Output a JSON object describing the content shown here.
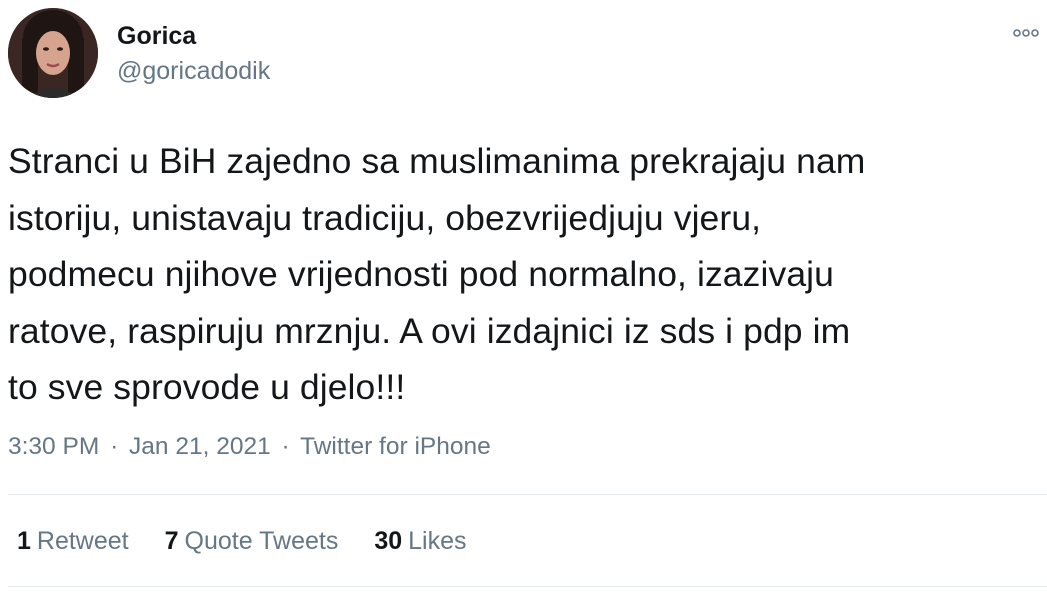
{
  "author": {
    "display_name": "Gorica",
    "handle": "@goricadodik",
    "avatar_icon": "profile-photo"
  },
  "tweet": {
    "text": "Stranci u BiH zajedno sa muslimanima prekrajaju nam\nistoriju, unistavaju tradiciju, obezvrijedjuju vjeru,\npodmecu njihove vrijednosti pod normalno, izazivaju\nratove, raspiruju mrznju. A ovi izdajnici iz sds i pdp im\nto sve sprovode u djelo!!!"
  },
  "meta": {
    "time": "3:30 PM",
    "separator": "·",
    "date": "Jan 21, 2021",
    "source": "Twitter for iPhone"
  },
  "stats": {
    "retweets": {
      "count": "1",
      "label": "Retweet"
    },
    "quotes": {
      "count": "7",
      "label": "Quote Tweets"
    },
    "likes": {
      "count": "30",
      "label": "Likes"
    }
  },
  "icons": {
    "more": "more-options-icon"
  },
  "colors": {
    "text_primary": "#14171a",
    "text_secondary": "#657786",
    "divider": "#e6ecf0",
    "background": "#ffffff"
  }
}
